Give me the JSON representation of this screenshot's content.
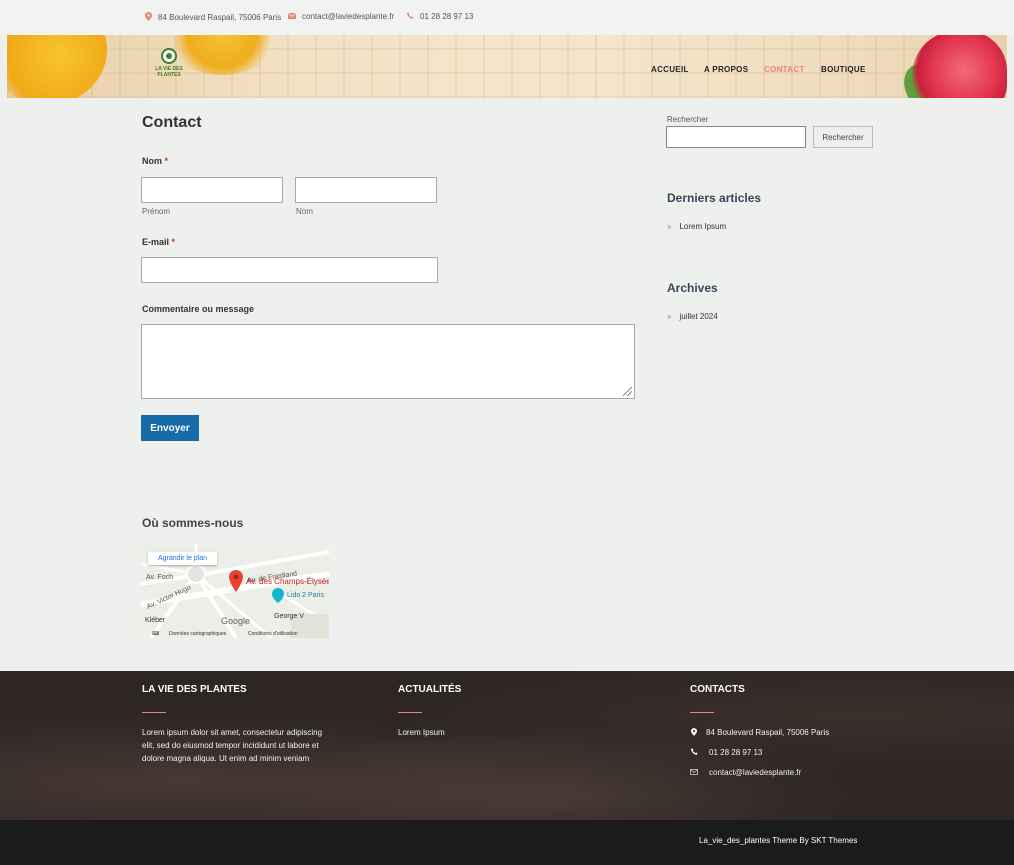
{
  "topbar": {
    "address": "84 Boulevard Raspail, 75006 Paris",
    "email": "contact@laviedesplante.fr",
    "phone": "01 28 28 97 13"
  },
  "header": {
    "logo_text": "LA VIE DES PLANTES",
    "nav": [
      "ACCUEIL",
      "A PROPOS",
      "CONTACT",
      "BOUTIQUE"
    ],
    "active_nav": "CONTACT",
    "accent_color": "#e8877a"
  },
  "main": {
    "title": "Contact",
    "form": {
      "name_label": "Nom",
      "required_mark": "*",
      "first_sublabel": "Prénom",
      "last_sublabel": "Nom",
      "email_label": "E-mail",
      "message_label": "Commentaire ou message",
      "submit_label": "Envoyer",
      "submit_color": "#176ba8"
    },
    "map_section": {
      "title": "Où sommes-nous",
      "enlarge_link": "Agrandir le plan",
      "labels": [
        "Av. de Friedland",
        "Av. Foch",
        "Av. des Champs-Élysées",
        "Av. Victor Hugo",
        "Lido 2 Paris",
        "George V",
        "Kléber"
      ],
      "brand": "Google",
      "footer_data": "Données cartographiques",
      "footer_terms": "Conditions d'utilisation"
    }
  },
  "sidebar": {
    "search_label": "Rechercher",
    "search_button": "Rechercher",
    "recent_title": "Derniers articles",
    "recent_items": [
      "Lorem Ipsum"
    ],
    "archives_title": "Archives",
    "archive_items": [
      "juillet 2024"
    ],
    "bullet": "»"
  },
  "footer": {
    "col1_title": "LA VIE DES PLANTES",
    "col1_text": "Lorem ipsum dolor sit amet, consectetur adipiscing elit, sed do eiusmod tempor incididunt ut labore et dolore magna aliqua. Ut enim ad minim veniam",
    "col2_title": "ACTUALITÉS",
    "col2_items": [
      "Lorem Ipsum"
    ],
    "col3_title": "CONTACTS",
    "address": "84 Boulevard Raspail, 75006 Paris",
    "phone": "01 28 28 97 13",
    "email": "contact@laviedesplante.fr",
    "credit": "La_vie_des_plantes Theme By SKT Themes"
  }
}
